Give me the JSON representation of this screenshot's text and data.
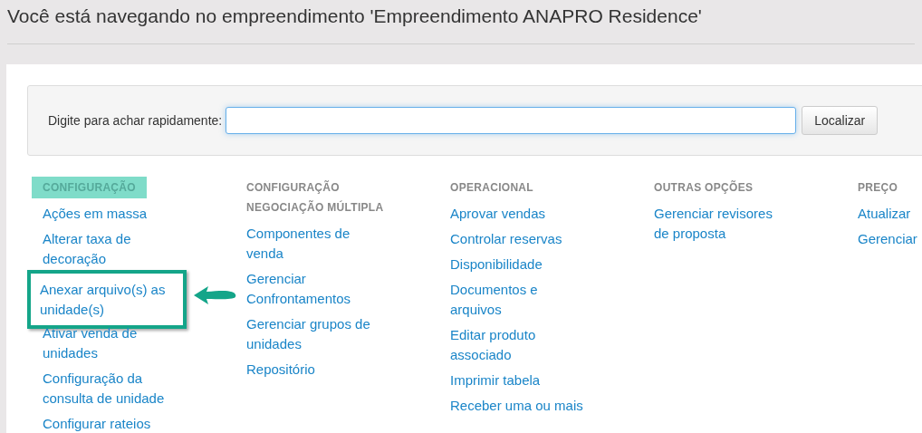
{
  "page_title": "Você está navegando no empreendimento 'Empreendimento ANAPRO Residence'",
  "search": {
    "label": "Digite para achar rapidamente:",
    "button": "Localizar"
  },
  "columns": [
    {
      "heading": "CONFIGURAÇÃO",
      "highlighted": true,
      "items": [
        {
          "label": "Ações em massa",
          "annotated": false
        },
        {
          "label": "Alterar taxa de decoração",
          "annotated": false
        },
        {
          "label": "Anexar arquivo(s) as unidade(s)",
          "annotated": true
        },
        {
          "label": "Ativar venda de unidades",
          "annotated": false
        },
        {
          "label": "Configuração da consulta de unidade",
          "annotated": false
        },
        {
          "label": "Configurar rateios",
          "annotated": false
        }
      ]
    },
    {
      "heading": "CONFIGURAÇÃO NEGOCIAÇÃO MÚLTIPLA",
      "highlighted": false,
      "items": [
        {
          "label": "Componentes de venda",
          "annotated": false
        },
        {
          "label": "Gerenciar Confrontamentos",
          "annotated": false
        },
        {
          "label": "Gerenciar grupos de unidades",
          "annotated": false
        },
        {
          "label": "Repositório",
          "annotated": false
        }
      ]
    },
    {
      "heading": "OPERACIONAL",
      "highlighted": false,
      "items": [
        {
          "label": "Aprovar vendas",
          "annotated": false
        },
        {
          "label": "Controlar reservas",
          "annotated": false
        },
        {
          "label": "Disponibilidade",
          "annotated": false
        },
        {
          "label": "Documentos e arquivos",
          "annotated": false
        },
        {
          "label": "Editar produto associado",
          "annotated": false
        },
        {
          "label": "Imprimir tabela",
          "annotated": false
        },
        {
          "label": "Receber uma ou mais",
          "annotated": false
        }
      ]
    },
    {
      "heading": "OUTRAS OPÇÕES",
      "highlighted": false,
      "items": [
        {
          "label": "Gerenciar revisores de proposta",
          "annotated": false
        }
      ]
    },
    {
      "heading": "PREÇO",
      "highlighted": false,
      "items": [
        {
          "label": "Atualizar",
          "annotated": false
        },
        {
          "label": "Gerenciar",
          "annotated": false
        }
      ]
    }
  ]
}
